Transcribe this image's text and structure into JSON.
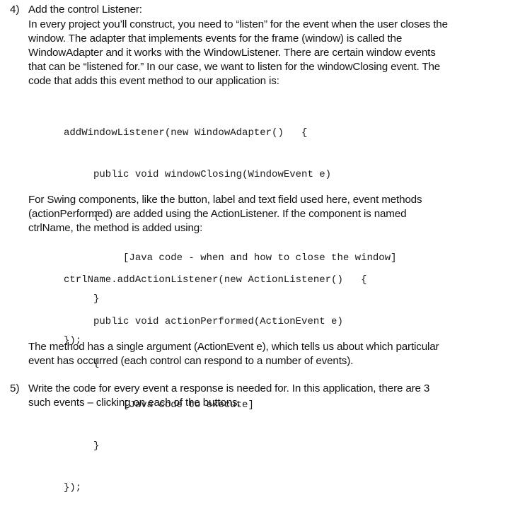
{
  "step4": {
    "number": "4)",
    "title": "Add the control Listener:",
    "intro_lines": [
      "In every project you’ll construct, you need to “listen” for the event when the user closes the",
      "window. The adapter that implements events for the frame (window) is called the",
      "WindowAdapter and it works with the WindowListener. There are certain window events",
      "that can be “listened for.” In our case, we want to listen for the windowClosing event. The",
      "code that adds this event method to our application is:"
    ],
    "code1": [
      "addWindowListener(new WindowAdapter()   {",
      "     public void windowClosing(WindowEvent e)",
      "     {",
      "          [Java code - when and how to close the window]",
      "     }",
      "});"
    ],
    "swing_lines": [
      "For Swing components, like the button, label and text field used here, event methods",
      "(actionPerformed) are added using the ActionListener. If the component is named",
      "ctrlName, the method is added using:"
    ],
    "code2": [
      "ctrlName.addActionListener(new ActionListener()   {",
      "     public void actionPerformed(ActionEvent e)",
      "     {",
      "          [Java code to execute]",
      "     }",
      "});"
    ],
    "method_lines": [
      "The method has a single argument (ActionEvent e), which tells us about which particular",
      "event has occurred (each control can respond to a number of events)."
    ]
  },
  "step5": {
    "number": "5)",
    "lines": [
      "Write the code for every event a response is needed for. In this application, there are 3",
      "such events – clicking on each of the buttons."
    ]
  }
}
